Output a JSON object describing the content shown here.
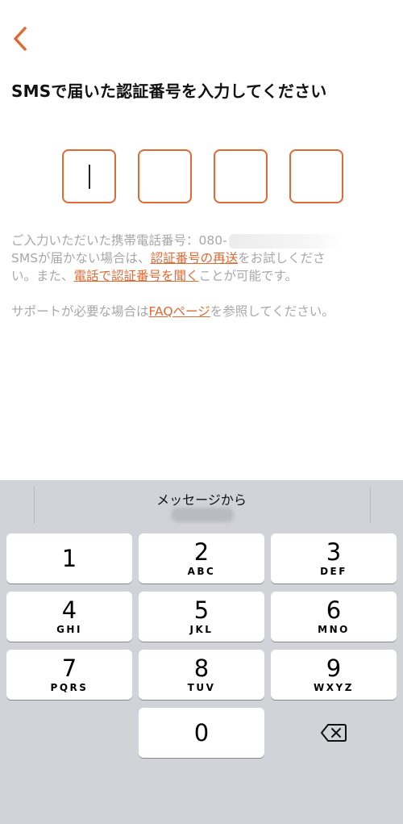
{
  "header": {
    "back_icon": "chevron-left-icon",
    "title": "SMSで届いた認証番号を入力してください"
  },
  "code": {
    "digits": [
      "",
      "",
      "",
      ""
    ],
    "length": 4
  },
  "info": {
    "phone_prefix": "ご入力いただいた携帯電話番号：080-",
    "line2_pre": "SMSが届かない場合は、",
    "resend_link": "認証番号の再送",
    "line2_post": "をお試しくださ",
    "line3_pre": "い。また、",
    "call_link": "電話で認証番号を聞く",
    "line3_post": "ことが可能です。",
    "support_pre": "サポートが必要な場合は",
    "faq_link": "FAQページ",
    "support_post": "を参照してください。"
  },
  "keyboard": {
    "suggestion": "メッセージから",
    "keys": [
      {
        "num": "1",
        "letters": ""
      },
      {
        "num": "2",
        "letters": "ABC"
      },
      {
        "num": "3",
        "letters": "DEF"
      },
      {
        "num": "4",
        "letters": "GHI"
      },
      {
        "num": "5",
        "letters": "JKL"
      },
      {
        "num": "6",
        "letters": "MNO"
      },
      {
        "num": "7",
        "letters": "PQRS"
      },
      {
        "num": "8",
        "letters": "TUV"
      },
      {
        "num": "9",
        "letters": "WXYZ"
      },
      {
        "num": "0",
        "letters": ""
      }
    ],
    "delete_icon": "backspace-icon"
  },
  "colors": {
    "accent": "#de6a35",
    "muted_text": "#a7a7a7",
    "keyboard_bg": "#d1d3d9"
  }
}
